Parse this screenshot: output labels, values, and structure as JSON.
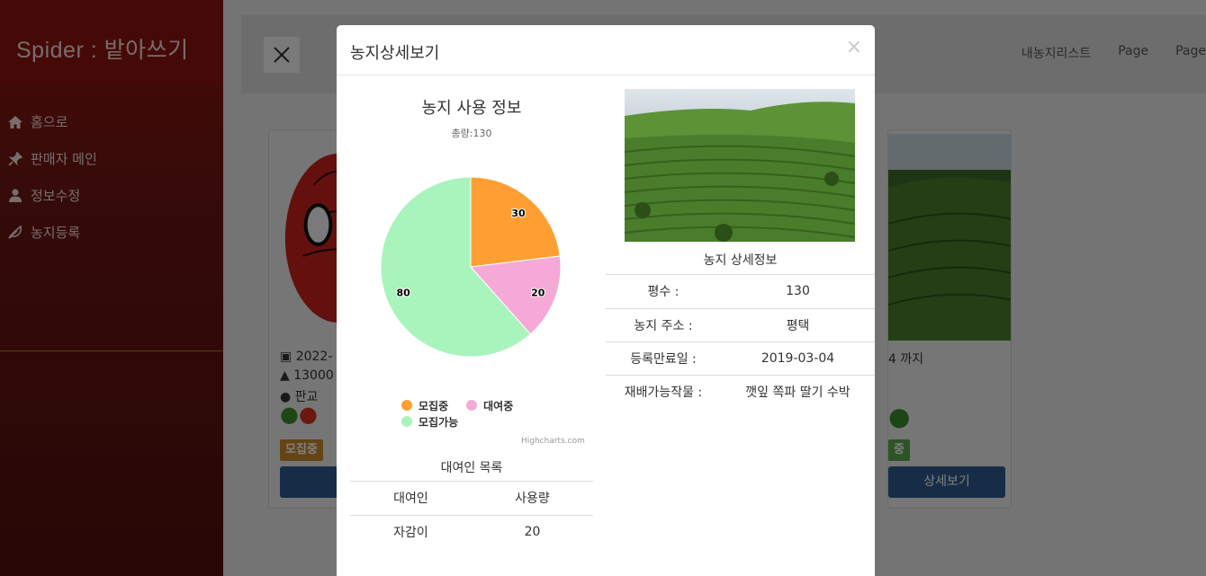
{
  "sidebar": {
    "brand": "Spider : 밭아쓰기",
    "items": [
      {
        "label": "홈으로",
        "icon": "home-icon"
      },
      {
        "label": "판매자 메인",
        "icon": "pin-icon"
      },
      {
        "label": "정보수정",
        "icon": "user-icon"
      },
      {
        "label": "농지등록",
        "icon": "leaf-icon"
      }
    ]
  },
  "topbar": {
    "links": [
      "내농지리스트",
      "Page",
      "Page"
    ]
  },
  "background_cards": {
    "left": {
      "date": "2022-",
      "price": "13000",
      "location": "판교",
      "badge": "모집중"
    },
    "right": {
      "date_suffix": "4 까지",
      "badge": "중",
      "button": "상세보기"
    }
  },
  "modal": {
    "title": "농지상세보기",
    "close": "×",
    "chart": {
      "title": "농지 사용 정보",
      "subtitle": "총량:130",
      "credits": "Highcharts.com"
    },
    "renters": {
      "caption": "대여인 목록",
      "headers": [
        "대여인",
        "사용량"
      ],
      "rows": [
        [
          "자감이",
          "20"
        ]
      ]
    },
    "detail": {
      "caption": "농지 상세정보",
      "rows": [
        {
          "key": "평수 :",
          "value": "130"
        },
        {
          "key": "농지 주소 :",
          "value": "평택"
        },
        {
          "key": "등록만료일 :",
          "value": "2019-03-04"
        },
        {
          "key": "재배가능작물 :",
          "value": "깻잎 쪽파 딸기 수박"
        }
      ]
    }
  },
  "chart_data": {
    "type": "pie",
    "title": "농지 사용 정보",
    "subtitle": "총량:130",
    "series": [
      {
        "name": "모집중",
        "value": 30,
        "color": "#ff9f33"
      },
      {
        "name": "대여중",
        "value": 20,
        "color": "#f4a9d6"
      },
      {
        "name": "모집가능",
        "value": 80,
        "color": "#a8f4bc"
      }
    ],
    "legend": "bottom"
  }
}
